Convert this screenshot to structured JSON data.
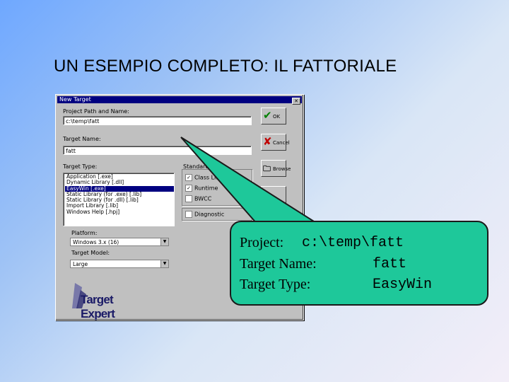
{
  "slide": {
    "title": "UN ESEMPIO COMPLETO: IL FATTORIALE"
  },
  "dialog": {
    "title": "New Target",
    "close": "✕",
    "project_label": "Project Path and Name:",
    "project_value": "c:\\temp\\fatt",
    "target_name_label": "Target Name:",
    "target_name_value": "fatt",
    "target_type_label": "Target Type:",
    "target_types": [
      "Application [.exe]",
      "Dynamic Library [.dll]",
      "EasyWin [.exe]",
      "Static Library (for .exe) [.lib]",
      "Static Library (for .dll) [.lib]",
      "Import Library [.lib]",
      "Windows Help [.hpj]"
    ],
    "selected_index": 2,
    "standard_label": "Standard",
    "checkboxes": [
      {
        "label": "Class Library",
        "checked": "✓"
      },
      {
        "label": "Runtime",
        "checked": "✓"
      },
      {
        "label": "BWCC",
        "checked": ""
      }
    ],
    "diagnostic_label": "Diagnostic",
    "platform_label": "Platform:",
    "platform_value": "Windows 3.x (16)",
    "model_label": "Target Model:",
    "model_value": "Large",
    "buttons": {
      "ok": "OK",
      "cancel": "Cancel",
      "browse": "Browse",
      "ok_icon": "✔",
      "cancel_icon": "✘",
      "browse_icon": "🗀"
    },
    "logo": "Target Expert"
  },
  "callout": {
    "rows": [
      {
        "label": "Project:",
        "value": "c:\\temp\\fatt"
      },
      {
        "label": "Target Name:",
        "value": "fatt"
      },
      {
        "label": "Target Type:",
        "value": "EasyWin"
      }
    ]
  }
}
